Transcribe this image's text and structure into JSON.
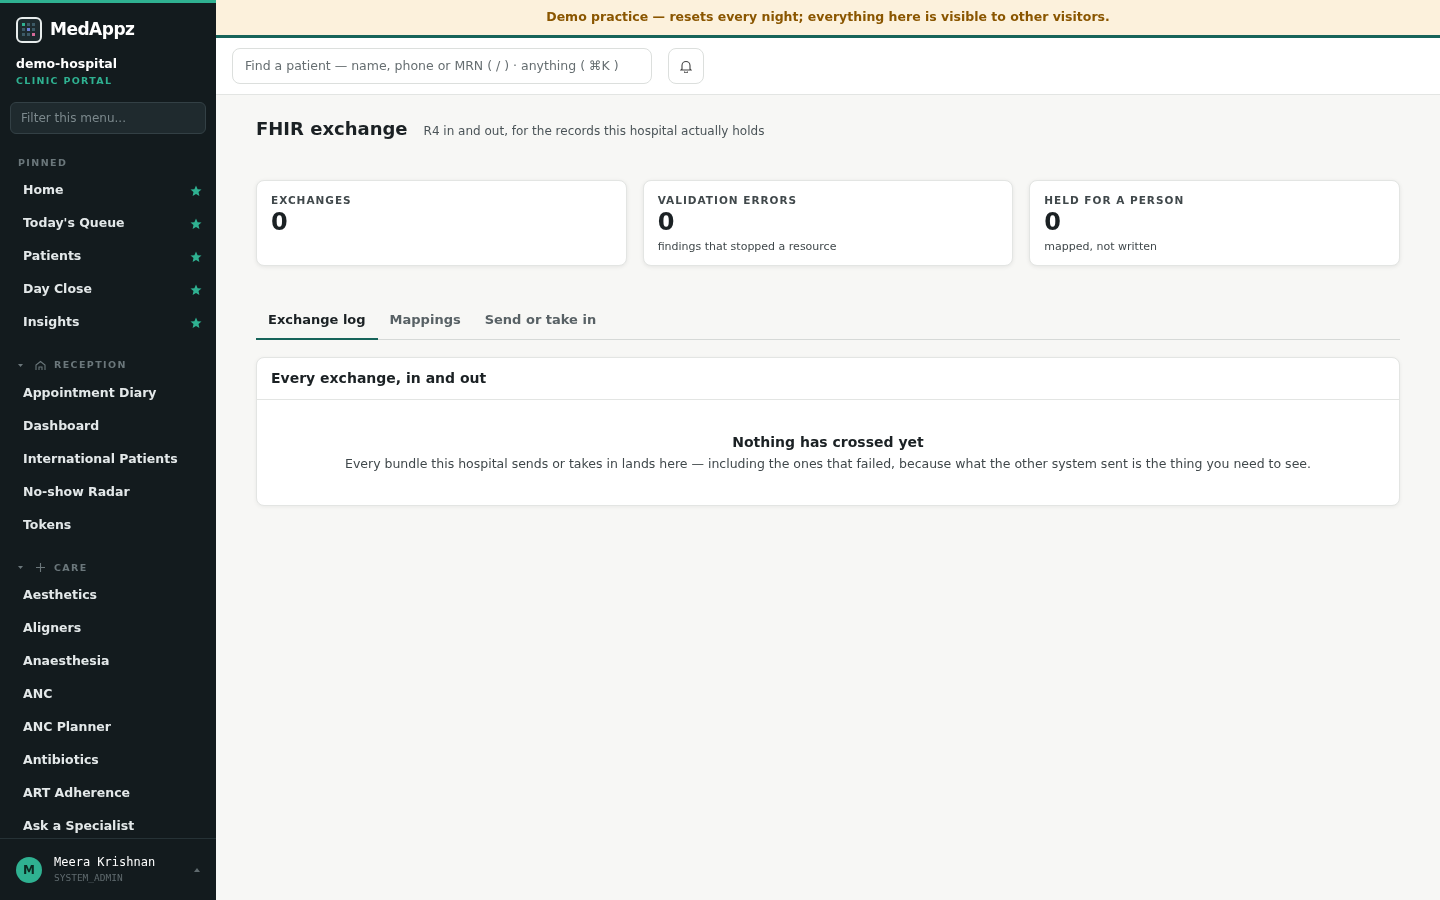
{
  "sidebar": {
    "brand": "MedAppz",
    "org": "demo-hospital",
    "portal": "CLINIC PORTAL",
    "filter": {
      "placeholder": "Filter this menu..."
    },
    "pinned": {
      "title": "PINNED",
      "items": [
        {
          "label": "Home",
          "starred": true
        },
        {
          "label": "Today's Queue",
          "starred": true
        },
        {
          "label": "Patients",
          "starred": true
        },
        {
          "label": "Day Close",
          "starred": true
        },
        {
          "label": "Insights",
          "starred": true
        }
      ]
    },
    "groups": [
      {
        "title": "RECEPTION",
        "expanded": true,
        "items": [
          "Appointment Diary",
          "Dashboard",
          "International Patients",
          "No-show Radar",
          "Tokens"
        ]
      },
      {
        "title": "CARE",
        "expanded": true,
        "items": [
          "Aesthetics",
          "Aligners",
          "Anaesthesia",
          "ANC",
          "ANC Planner",
          "Antibiotics",
          "ART Adherence",
          "Ask a Specialist"
        ]
      }
    ],
    "user": {
      "initial": "M",
      "name": "Meera Krishnan",
      "role": "SYSTEM_ADMIN"
    }
  },
  "banner": "Demo practice — resets every night; everything here is visible to other visitors.",
  "search": {
    "placeholder": "Find a patient — name, phone or MRN ( / ) · anything ( ⌘K )"
  },
  "page": {
    "title": "FHIR exchange",
    "subtitle": "R4 in and out, for the records this hospital actually holds"
  },
  "stats": [
    {
      "label": "EXCHANGES",
      "value": "0"
    },
    {
      "label": "VALIDATION ERRORS",
      "value": "0",
      "note": "findings that stopped a resource"
    },
    {
      "label": "HELD FOR A PERSON",
      "value": "0",
      "note": "mapped, not written"
    }
  ],
  "tabs": [
    {
      "label": "Exchange log",
      "selected": true
    },
    {
      "label": "Mappings",
      "selected": false
    },
    {
      "label": "Send or take in",
      "selected": false
    }
  ],
  "panel": {
    "title": "Every exchange, in and out",
    "empty_title": "Nothing has crossed yet",
    "empty_text": "Every bundle this hospital sends or takes in lands here — including the ones that failed, because what the other system sent is the thing you need to see."
  }
}
